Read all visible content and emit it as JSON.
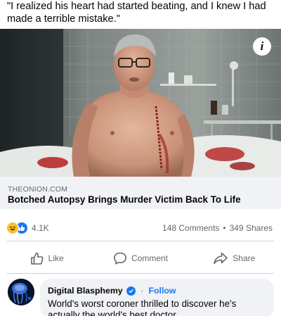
{
  "post": {
    "text": "\"I realized his heart had started beating, and I knew I had made a terrible mistake.\""
  },
  "link_preview": {
    "domain": "THEONION.COM",
    "title": "Botched Autopsy Brings Murder Victim Back To Life",
    "info_icon": "info-icon"
  },
  "stats": {
    "reaction_icons": [
      "haha-icon",
      "like-icon"
    ],
    "reaction_count": "4.1K",
    "comments": "148 Comments",
    "separator": "•",
    "shares": "349 Shares"
  },
  "actions": {
    "like": "Like",
    "comment": "Comment",
    "share": "Share"
  },
  "top_comment": {
    "author": "Digital Blasphemy",
    "separator": "·",
    "follow_label": "Follow",
    "text": "World's worst coroner thrilled to discover he's actually the world's best doctor."
  },
  "colors": {
    "facebook_blue": "#1877f2",
    "secondary_text": "#65676b",
    "card_background": "#f0f2f5",
    "haha_yellow": "#f7c132"
  }
}
